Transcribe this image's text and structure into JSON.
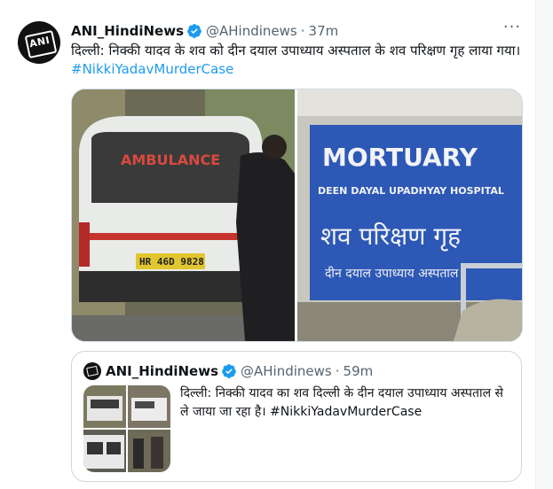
{
  "tweet": {
    "author_name": "ANI_HindiNews",
    "handle": "@AHindinews",
    "separator": "·",
    "time": "37m",
    "more_icon": "more-horizontal-icon",
    "text_main": "दिल्ली: निक्की यादव के शव को दीन दयाल उपाध्याय अस्पताल के शव परिक्षण गृह लाया गया।",
    "hashtag": "#NikkiYadavMurderCase",
    "media": {
      "left_photo": {
        "van_label": "AMBULANCE",
        "plate": "HR 46D 9828"
      },
      "right_photo": {
        "sign_line1": "MORTUARY",
        "sign_line2": "DEEN DAYAL UPADHYAY HOSPITAL",
        "sign_line3": "शव परिक्षण गृह",
        "sign_line4": "दीन दयाल उपाध्याय अस्पताल"
      }
    }
  },
  "quote": {
    "author_name": "ANI_HindiNews",
    "handle": "@AHindinews",
    "separator": "·",
    "time": "59m",
    "text_main": "दिल्ली: निक्की यादव का शव दिल्ली के दीन दयाल उपाध्याय अस्पताल से ले जाया जा रहा है।",
    "hashtag": "#NikkiYadavMurderCase"
  },
  "colors": {
    "link": "#1d9bf0",
    "verified": "#1d9bf0",
    "secondary_text": "#536471",
    "border": "#cfd9de"
  }
}
